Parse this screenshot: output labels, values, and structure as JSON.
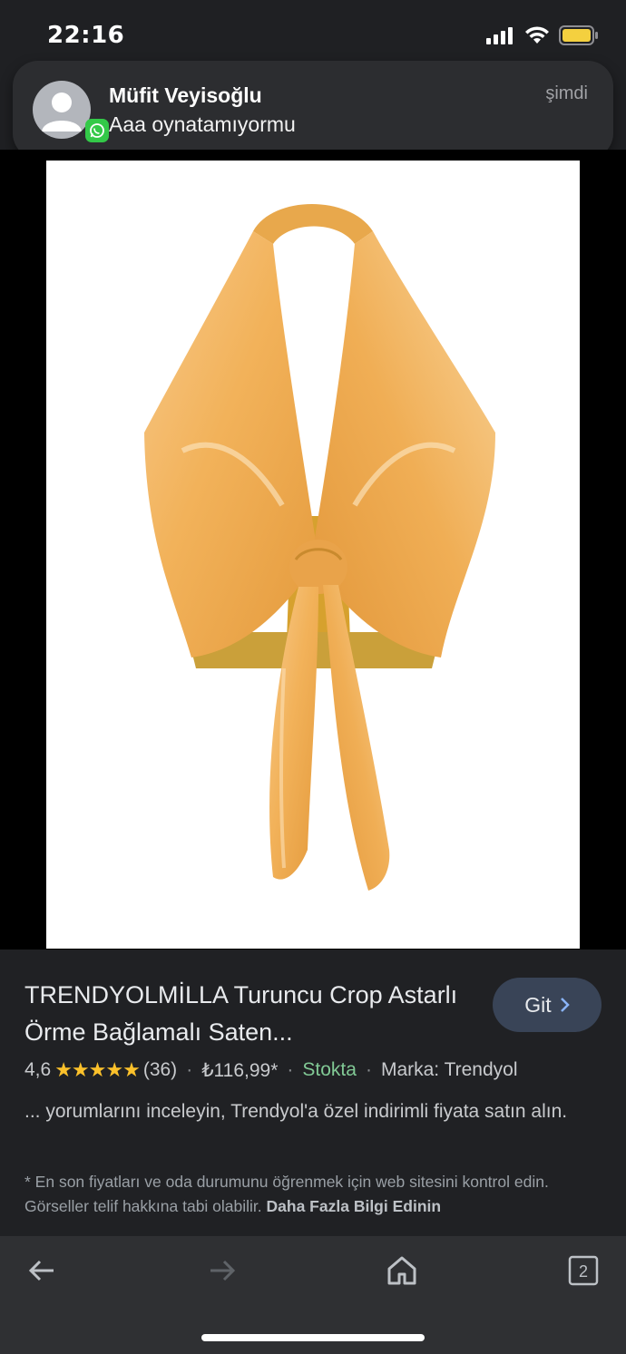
{
  "status": {
    "time": "22:16"
  },
  "notification": {
    "sender": "Müfit Veyisoğlu",
    "message": "Aaa oynatamıyormu",
    "time": "şimdi",
    "app_icon": "whatsapp-icon"
  },
  "product": {
    "title": "TRENDYOLMİLLA Turuncu Crop Astarlı Örme Bağlamalı Saten...",
    "go_button": "Git",
    "rating": "4,6",
    "stars": "★★★★★",
    "review_count": "(36)",
    "price": "₺116,99*",
    "availability": "Stokta",
    "brand": "Marka: Trendyol",
    "description": "... yorumlarını inceleyin, Trendyol'a özel indirimli fiyata satın alın.",
    "disclaimer": "* En son fiyatları ve oda durumunu öğrenmek için web sitesini kontrol edin. Görseller telif hakkına tabi olabilir.",
    "more_info": "Daha Fazla Bilgi Edinin"
  },
  "nav": {
    "tab_count": "2"
  },
  "colors": {
    "accent_button": "#394457",
    "in_stock": "#81c995",
    "star": "#fbc12b",
    "garment": "#f2b45d"
  }
}
